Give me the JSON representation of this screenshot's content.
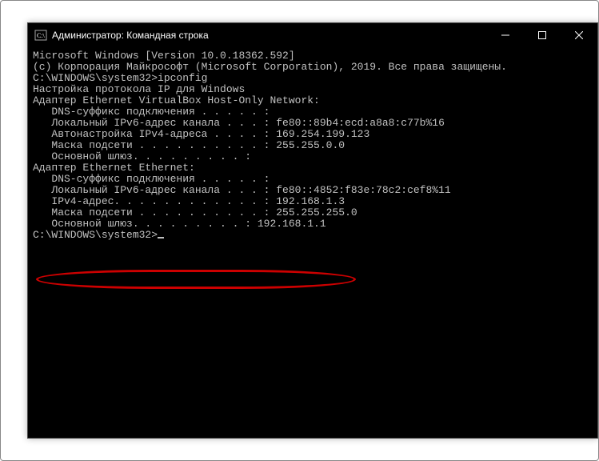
{
  "window": {
    "title": "Администратор: Командная строка"
  },
  "terminal": {
    "lines": [
      "Microsoft Windows [Version 10.0.18362.592]",
      "(c) Корпорация Майкрософт (Microsoft Corporation), 2019. Все права защищены.",
      "",
      "C:\\WINDOWS\\system32>ipconfig",
      "",
      "Настройка протокола IP для Windows",
      "",
      "",
      "Адаптер Ethernet VirtualBox Host-Only Network:",
      "",
      "   DNS-суффикс подключения . . . . . :",
      "   Локальный IPv6-адрес канала . . . : fe80::89b4:ecd:a8a8:c77b%16",
      "   Автонастройка IPv4-адреса . . . . : 169.254.199.123",
      "   Маска подсети . . . . . . . . . . : 255.255.0.0",
      "   Основной шлюз. . . . . . . . . :",
      "",
      "Адаптер Ethernet Ethernet:",
      "",
      "   DNS-суффикс подключения . . . . . :",
      "   Локальный IPv6-адрес канала . . . : fe80::4852:f83e:78c2:cef8%11",
      "   IPv4-адрес. . . . . . . . . . . . : 192.168.1.3",
      "   Маска подсети . . . . . . . . . . : 255.255.255.0",
      "   Основной шлюз. . . . . . . . . : 192.168.1.1",
      "",
      "C:\\WINDOWS\\system32>"
    ],
    "prompt_cursor": true
  },
  "highlight": {
    "target_line_index": 20
  }
}
